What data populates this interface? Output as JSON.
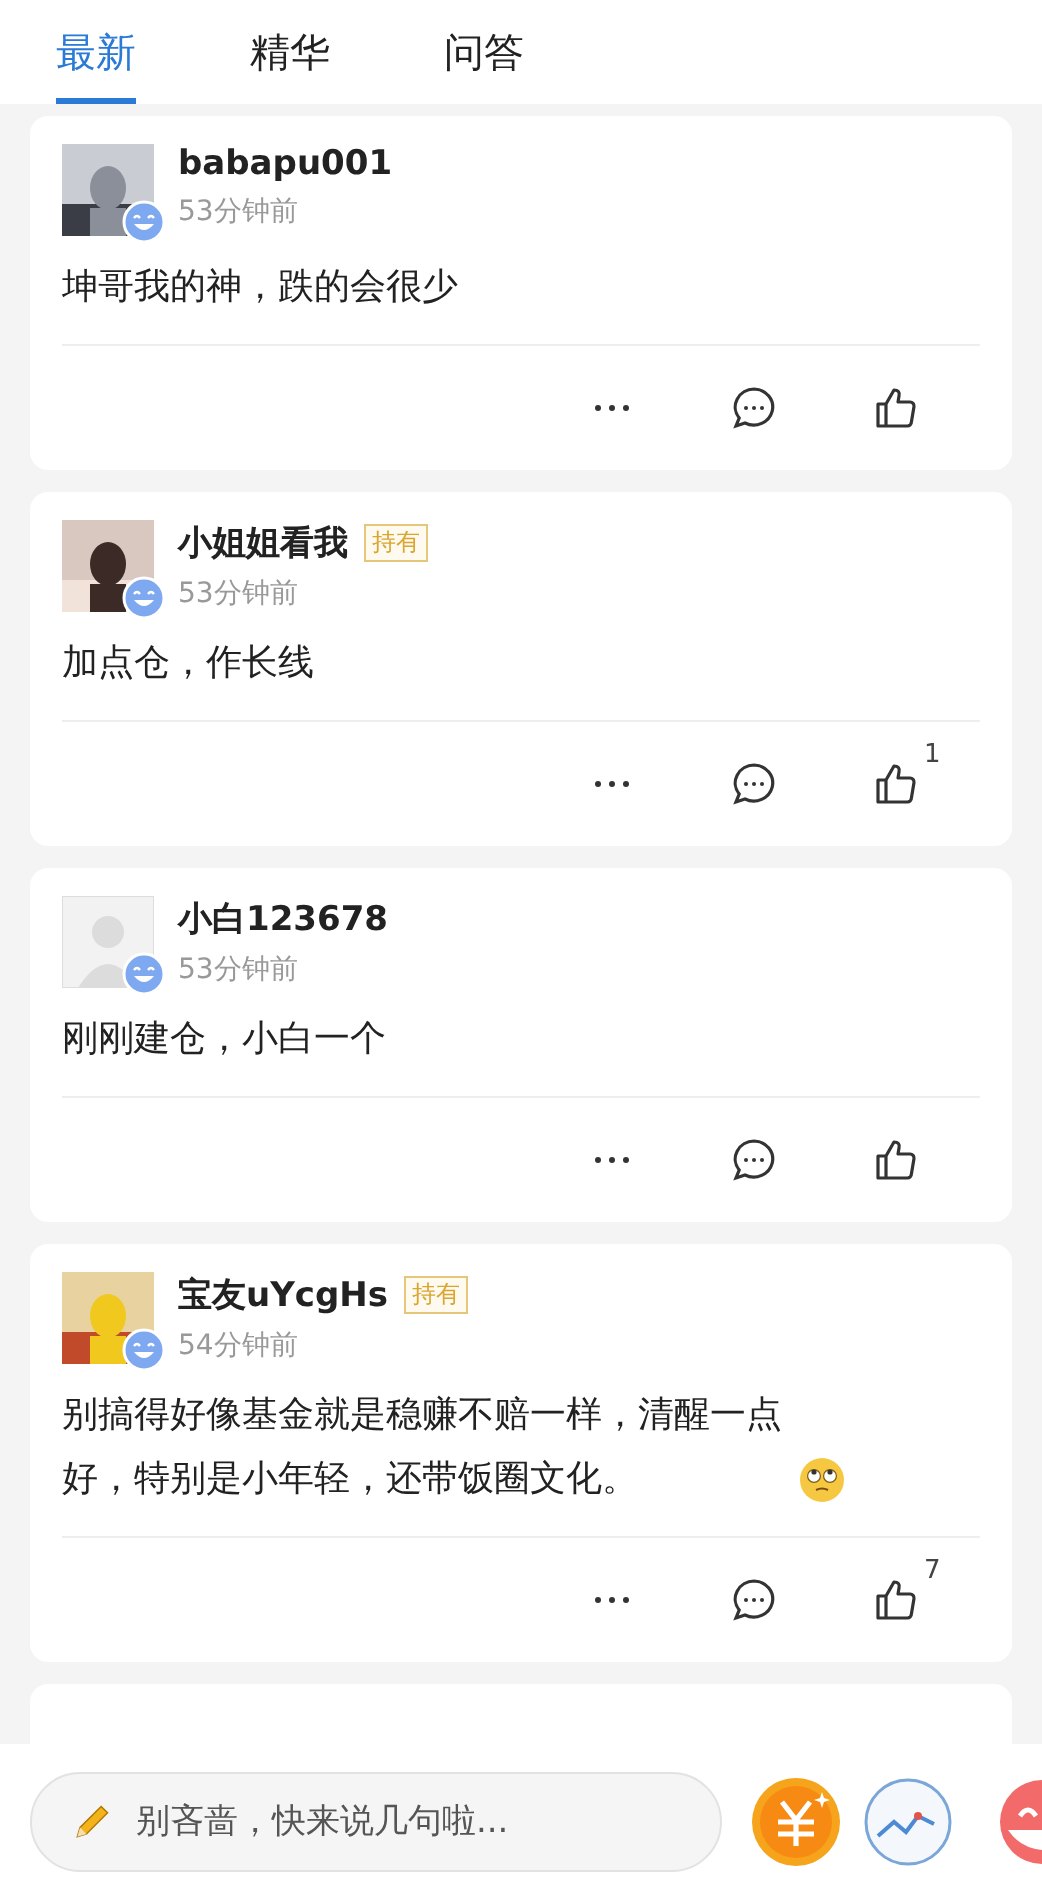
{
  "tabs": [
    {
      "label": "最新",
      "selected": true
    },
    {
      "label": "精华",
      "selected": false
    },
    {
      "label": "问答",
      "selected": false
    }
  ],
  "posts": [
    {
      "user": "babapu001",
      "holding": false,
      "time": "53分钟前",
      "text": "坤哥我的神，跌的会很少",
      "emoji": false
    },
    {
      "user": "小姐姐看我",
      "holding": true,
      "badge": "持有",
      "time": "53分钟前",
      "text": "加点仓，作长线",
      "emoji": false,
      "likes": "1"
    },
    {
      "avatar": {
        "kind": "default"
      },
      "user": "小白123678",
      "holding": false,
      "time": "53分钟前",
      "text": "刚刚建仓，小白一个",
      "emoji": false
    },
    {
      "user": "宝友uYcgHs",
      "holding": true,
      "badge": "持有",
      "time": "54分钟前",
      "text": "别搞得好像基金就是稳赚不赔一样，清醒一点好，特别是小年轻，还带饭圈文化。",
      "emoji": true,
      "likes": "7"
    }
  ],
  "comment_bar": {
    "placeholder": "别吝啬，快来说几句啦..."
  }
}
